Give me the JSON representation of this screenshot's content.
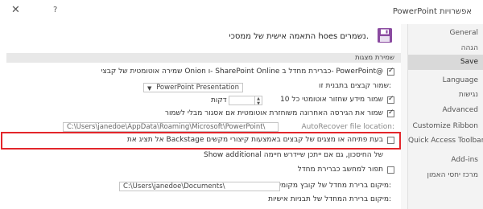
{
  "window": {
    "title": "PowerPoint אפשרויות",
    "close_label": "✕",
    "help_label": "?"
  },
  "sidebar": {
    "items": [
      {
        "label": "General",
        "active": false
      },
      {
        "label": "הגהה",
        "active": false
      },
      {
        "label": "Save",
        "active": true
      },
      {
        "label": "Language",
        "active": false
      },
      {
        "label": "נגישות",
        "active": false
      },
      {
        "label": "Advanced",
        "active": false
      },
      {
        "label": "Customize Ribbon",
        "active": false
      },
      {
        "label": "Quick Access Toolbar",
        "active": false
      },
      {
        "label": "Add-ins",
        "active": false
      },
      {
        "label": "מרכז יחסי האמון",
        "active": false
      }
    ]
  },
  "header": {
    "text": "התאמה אישית של ממסכי hoes נשמרים."
  },
  "save_section": {
    "title": "שמירת מצגות",
    "autosave_label": "שמירה אוטומטית של קבצי Onion ו- SharePoint Online כברירת מחדל ב- PowerPoint@",
    "format_label": "שמור קבצים בתבנית זו:",
    "format_value": "PowerPoint Presentation",
    "autorecover_label": "שמור מידע שחזור אוטומטי כל 10",
    "autorecover_minutes": "10",
    "minutes_label": "דקות",
    "keep_last_label": "שמור את הגירסה האחרונה משוחזרת אוטומטית אם אסגור מבלי לשמור",
    "autorecover_location_label": "AutoRecover file location:",
    "autorecover_location_value": "C:\\Users\\janedoe\\AppData\\Roaming\\Microsoft\\PowerPoint\\",
    "backstage_label": "אל תציג את Backstage בעת פתיחה או מצגים של קבצים באמצעות קיצורי מקשים",
    "show_additional_label": "Show additional של החיסכון, גם אם ייתכן שיידרש חיימה",
    "save_default_label": "תפור למחשב כברירת מחדל",
    "default_local_label": "מיקום ברירת מחדל של קובץ מקומי:",
    "default_local_value": "C:\\Users\\janedoe\\Documents\\",
    "personal_templates_label": "מיקום ברירת המחדל של תבניות אישיות:"
  }
}
